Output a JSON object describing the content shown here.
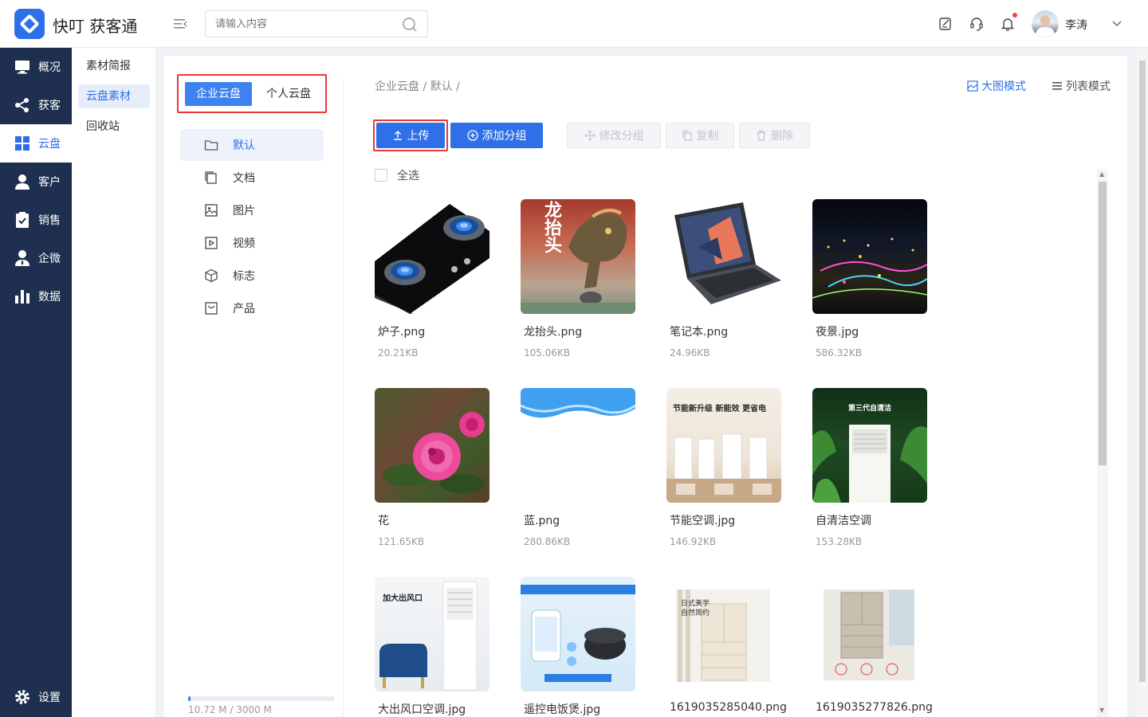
{
  "header": {
    "brand": "快叮 获客通",
    "search_placeholder": "请输入内容",
    "user_name": "李涛"
  },
  "nav": {
    "items": [
      {
        "label": "概况",
        "icon": "monitor-icon"
      },
      {
        "label": "获客",
        "icon": "share-icon"
      },
      {
        "label": "云盘",
        "icon": "grid-icon"
      },
      {
        "label": "客户",
        "icon": "person-icon"
      },
      {
        "label": "销售",
        "icon": "clipboard-check-icon"
      },
      {
        "label": "企微",
        "icon": "user-tie-icon"
      },
      {
        "label": "数据",
        "icon": "bar-chart-icon"
      }
    ],
    "active": "云盘",
    "settings_label": "设置"
  },
  "submenu": {
    "items": [
      "素材简报",
      "云盘素材",
      "回收站"
    ],
    "active": "云盘素材"
  },
  "cloud_tabs": {
    "enterprise": "企业云盘",
    "personal": "个人云盘",
    "active": "企业云盘"
  },
  "categories": [
    {
      "label": "默认",
      "icon": "folder-icon"
    },
    {
      "label": "文档",
      "icon": "document-icon"
    },
    {
      "label": "图片",
      "icon": "image-icon"
    },
    {
      "label": "视频",
      "icon": "video-icon"
    },
    {
      "label": "标志",
      "icon": "cube-icon"
    },
    {
      "label": "产品",
      "icon": "product-icon"
    }
  ],
  "storage": {
    "text": "10.72 M / 3000 M",
    "used_fraction": 0.0036
  },
  "breadcrumb": "企业云盘 / 默认 /",
  "view_modes": {
    "big": "大图模式",
    "list": "列表模式",
    "active": "大图模式"
  },
  "toolbar": {
    "upload": "上传",
    "add_group": "添加分组",
    "edit_group": "修改分组",
    "copy": "复制",
    "delete": "删除"
  },
  "select_all": "全选",
  "files": [
    {
      "name": "炉子.png",
      "size": "20.21KB"
    },
    {
      "name": "龙抬头.png",
      "size": "105.06KB"
    },
    {
      "name": "笔记本.png",
      "size": "24.96KB"
    },
    {
      "name": "夜景.jpg",
      "size": "586.32KB"
    },
    {
      "name": "花",
      "size": "121.65KB"
    },
    {
      "name": "蓝.png",
      "size": "280.86KB"
    },
    {
      "name": "节能空调.jpg",
      "size": "146.92KB"
    },
    {
      "name": "自清洁空调",
      "size": "153.28KB"
    },
    {
      "name": "大出风口空调.jpg",
      "size": ""
    },
    {
      "name": "遥控电饭煲.jpg",
      "size": ""
    },
    {
      "name": "1619035285040.png",
      "size": ""
    },
    {
      "name": "1619035277826.png",
      "size": ""
    }
  ],
  "thumb_text": {
    "dragon": "龙抬头",
    "ac_eco": "节能新升级 新能效 更省电",
    "ac_clean": "第三代自清洁",
    "ac_outlet": "加大出风口",
    "fridge1": "日式美学 自然简约"
  }
}
